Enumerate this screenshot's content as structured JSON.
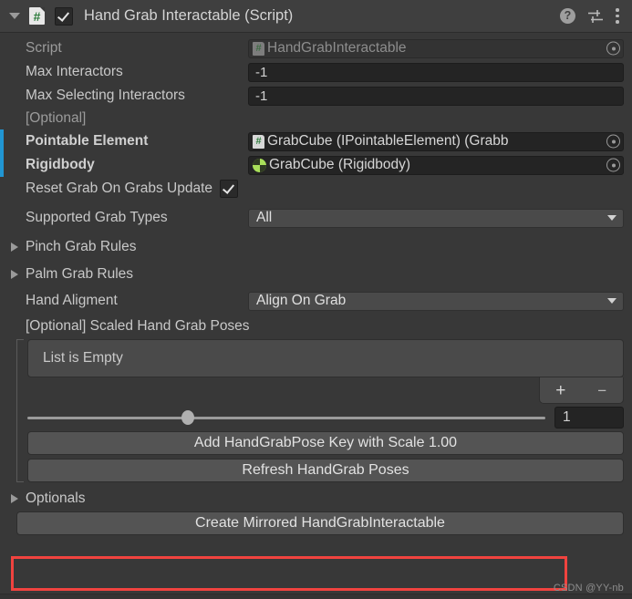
{
  "header": {
    "foldout_icon": "chevron-down-icon",
    "script_icon": "script-file-icon",
    "script_icon_glyph": "#",
    "enabled_checkbox": true,
    "title": "Hand Grab Interactable (Script)",
    "help_icon": "help-icon",
    "help_glyph": "?",
    "preset_icon": "preset-sliders-icon",
    "menu_icon": "kebab-menu-icon"
  },
  "fields": {
    "script": {
      "label": "Script",
      "value": "HandGrabInteractable",
      "icon": "script-file-icon",
      "icon_glyph": "#",
      "picker_icon": "object-picker-icon"
    },
    "max_interactors": {
      "label": "Max Interactors",
      "value": "-1"
    },
    "max_selecting_interactors": {
      "label": "Max Selecting Interactors",
      "value": "-1"
    },
    "optional_header": "[Optional]",
    "pointable_element": {
      "label": "Pointable Element",
      "value": "GrabCube (IPointableElement) (Grabb",
      "icon": "script-file-icon",
      "icon_glyph": "#",
      "picker_icon": "object-picker-icon",
      "overridden": true
    },
    "rigidbody": {
      "label": "Rigidbody",
      "value": "GrabCube (Rigidbody)",
      "icon": "rigidbody-icon",
      "picker_icon": "object-picker-icon",
      "overridden": true
    },
    "reset_grab_on_grabs_update": {
      "label": "Reset Grab On Grabs Update",
      "checked": true
    },
    "supported_grab_types": {
      "label": "Supported Grab Types",
      "value": "All",
      "caret_icon": "chevron-down-icon"
    },
    "pinch_grab_rules": {
      "label": "Pinch Grab Rules",
      "foldout_icon": "chevron-right-icon"
    },
    "palm_grab_rules": {
      "label": "Palm Grab Rules",
      "foldout_icon": "chevron-right-icon"
    },
    "hand_aligment": {
      "label": "Hand Aligment",
      "value": "Align On Grab",
      "caret_icon": "chevron-down-icon"
    },
    "scaled_poses_header": "[Optional] Scaled Hand Grab Poses"
  },
  "list": {
    "empty_text": "List is Empty",
    "add_button": "+",
    "remove_button": "−",
    "add_icon": "plus-icon",
    "remove_icon": "minus-icon"
  },
  "slider": {
    "value": "1",
    "knob_percent": 31
  },
  "buttons": {
    "add_pose_key": "Add HandGrabPose Key with Scale 1.00",
    "refresh_poses": "Refresh HandGrab Poses",
    "create_mirrored": "Create Mirrored HandGrabInteractable"
  },
  "optionals": {
    "label": "Optionals",
    "foldout_icon": "chevron-right-icon"
  },
  "watermark": "CSDN @YY-nb",
  "colors": {
    "background": "#383838",
    "header_bg": "#3f3f3f",
    "override_blue": "#2196d3",
    "highlight_red": "#f1433f",
    "rigidbody_green": "#a9e05a",
    "script_green": "#2f7d3e"
  }
}
